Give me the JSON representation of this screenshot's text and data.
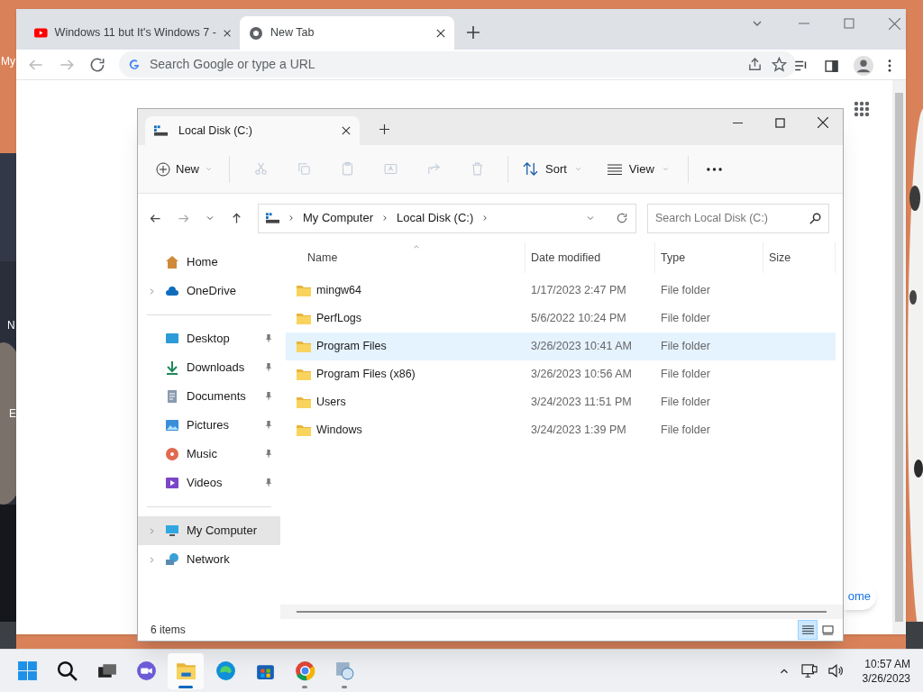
{
  "desktop": {
    "icon_labels": [
      "My",
      "N",
      "E"
    ]
  },
  "browser": {
    "tabs": [
      {
        "title": "Windows 11 but It's Windows 7 -",
        "selected": false
      },
      {
        "title": "New Tab",
        "selected": true
      }
    ],
    "address_placeholder": "Search Google or type a URL",
    "page": {
      "home_button": "ome"
    }
  },
  "explorer": {
    "tabs": [
      {
        "title": "Local Disk (C:)",
        "selected": true
      }
    ],
    "new_button": "New",
    "actions": [
      {
        "disabled": true
      },
      {
        "disabled": true
      },
      {
        "disabled": true
      },
      {
        "disabled": true
      },
      {
        "disabled": true
      },
      {
        "disabled": true
      }
    ],
    "sort_button": "Sort",
    "view_button": "View",
    "breadcrumb": [
      "My Computer",
      "Local Disk (C:)"
    ],
    "search_placeholder": "Search Local Disk (C:)",
    "nav_sections": [
      [
        {
          "label": "Home",
          "expandable": false,
          "pinned": false,
          "selected": false
        },
        {
          "label": "OneDrive",
          "expandable": true,
          "pinned": false,
          "selected": false
        }
      ],
      [
        {
          "label": "Desktop",
          "expandable": false,
          "pinned": true,
          "selected": false
        },
        {
          "label": "Downloads",
          "expandable": false,
          "pinned": true,
          "selected": false
        },
        {
          "label": "Documents",
          "expandable": false,
          "pinned": true,
          "selected": false
        },
        {
          "label": "Pictures",
          "expandable": false,
          "pinned": true,
          "selected": false
        },
        {
          "label": "Music",
          "expandable": false,
          "pinned": true,
          "selected": false
        },
        {
          "label": "Videos",
          "expandable": false,
          "pinned": true,
          "selected": false
        }
      ],
      [
        {
          "label": "My Computer",
          "expandable": true,
          "pinned": false,
          "selected": true
        },
        {
          "label": "Network",
          "expandable": true,
          "pinned": false,
          "selected": false
        }
      ]
    ],
    "columns": [
      "Name",
      "Date modified",
      "Type",
      "Size"
    ],
    "rows": [
      {
        "name": "mingw64",
        "date": "1/17/2023 2:47 PM",
        "type": "File folder",
        "selected": false
      },
      {
        "name": "PerfLogs",
        "date": "5/6/2022 10:24 PM",
        "type": "File folder",
        "selected": false
      },
      {
        "name": "Program Files",
        "date": "3/26/2023 10:41 AM",
        "type": "File folder",
        "selected": true
      },
      {
        "name": "Program Files (x86)",
        "date": "3/26/2023 10:56 AM",
        "type": "File folder",
        "selected": false
      },
      {
        "name": "Users",
        "date": "3/24/2023 11:51 PM",
        "type": "File folder",
        "selected": false
      },
      {
        "name": "Windows",
        "date": "3/24/2023 1:39 PM",
        "type": "File folder",
        "selected": false
      }
    ],
    "status": "6 items",
    "view_modes": [
      {
        "selected": true
      },
      {
        "selected": false
      }
    ]
  },
  "taskbar": {
    "apps": [
      {
        "active": false,
        "running": false
      },
      {
        "active": false,
        "running": false
      },
      {
        "active": false,
        "running": false
      },
      {
        "active": false,
        "running": false
      },
      {
        "active": true,
        "running": true
      },
      {
        "active": false,
        "running": false
      },
      {
        "active": false,
        "running": false
      },
      {
        "active": false,
        "running": true
      },
      {
        "active": false,
        "running": true
      }
    ],
    "time": "10:57 AM",
    "date": "3/26/2023"
  }
}
